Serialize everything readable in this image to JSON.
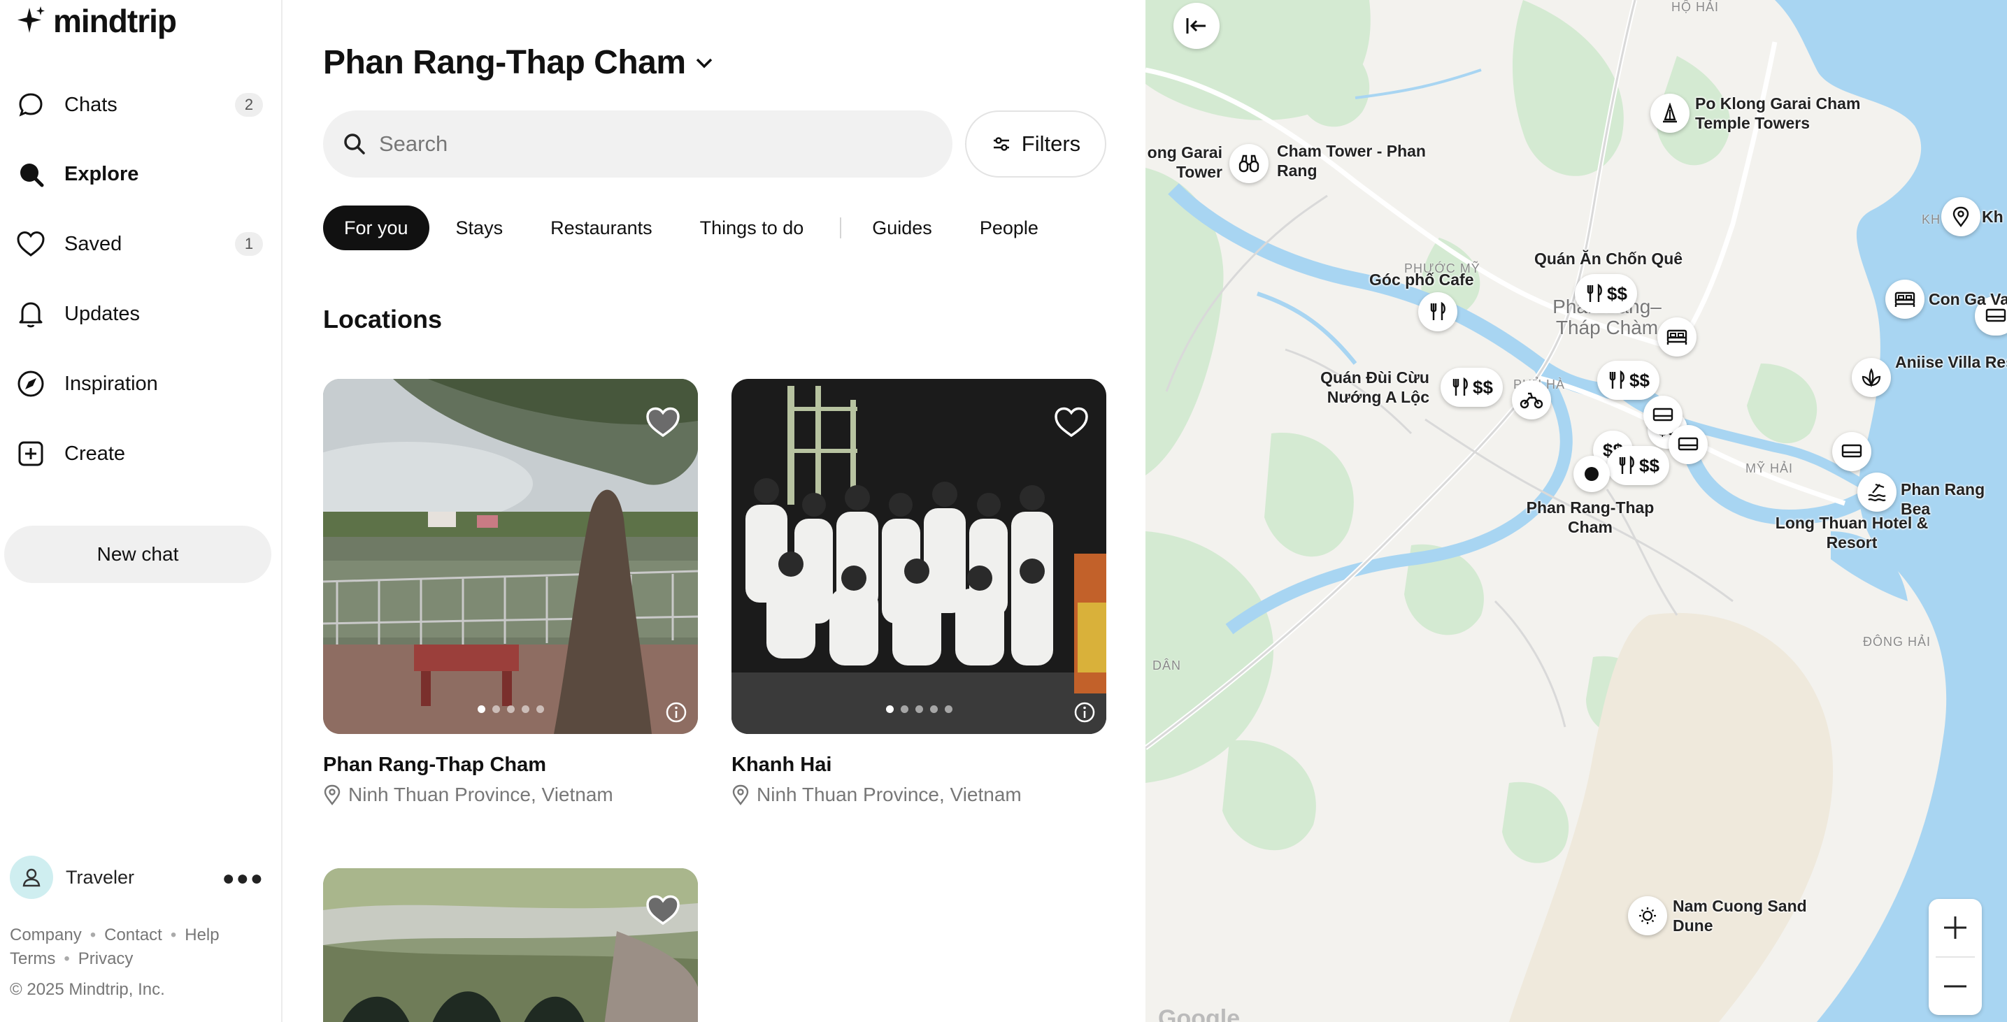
{
  "app": {
    "name": "mindtrip"
  },
  "sidebar": {
    "items": [
      {
        "label": "Chats",
        "count": "2",
        "icon": "chat-bubble-icon"
      },
      {
        "label": "Explore",
        "icon": "search-icon"
      },
      {
        "label": "Saved",
        "count": "1",
        "icon": "heart-icon"
      },
      {
        "label": "Updates",
        "icon": "bell-icon"
      },
      {
        "label": "Inspiration",
        "icon": "compass-icon"
      },
      {
        "label": "Create",
        "icon": "plus-square-icon"
      }
    ],
    "new_chat_label": "New chat",
    "user": {
      "name": "Traveler"
    },
    "footer": {
      "links_row1": [
        "Company",
        "Contact",
        "Help"
      ],
      "links_row2": [
        "Terms",
        "Privacy"
      ],
      "copyright": "© 2025 Mindtrip, Inc."
    }
  },
  "main": {
    "title": "Phan Rang-Thap Cham",
    "search": {
      "placeholder": "Search",
      "value": ""
    },
    "filters_label": "Filters",
    "tabs": [
      {
        "label": "For you",
        "active": true
      },
      {
        "label": "Stays"
      },
      {
        "label": "Restaurants"
      },
      {
        "label": "Things to do"
      },
      {
        "label": "Guides"
      },
      {
        "label": "People"
      }
    ],
    "section_title": "Locations",
    "cards": [
      {
        "title": "Phan Rang-Thap Cham",
        "location": "Ninh Thuan Province, Vietnam",
        "saved": true,
        "photo_count": 5,
        "active_photo": 1
      },
      {
        "title": "Khanh Hai",
        "location": "Ninh Thuan Province, Vietnam",
        "saved": false,
        "photo_count": 5,
        "active_photo": 1
      },
      {
        "title": "",
        "location": "",
        "saved": true
      }
    ]
  },
  "map": {
    "labels": {
      "po_klong": "Po Klong Garai Cham Temple Towers",
      "cham_tower": "Cham Tower - Phan Rang",
      "ong_garai": "ong Garai Tower",
      "quan_an": "Quán Ăn Chốn Quê",
      "goc_pho": "Góc phố Cafe",
      "quan_dui": "Quán Đùi Cừu Nướng A Lộc",
      "con_ga": "Con Ga Va",
      "aniise": "Aniise Villa Res",
      "phan_rang_bea": "Phan Rang Bea",
      "long_thuan": "Long Thuan Hotel & Resort",
      "phan_rang_thap_cham": "Phan Rang-Thap Cham",
      "nam_cuong": "Nam Cuong Sand Dune",
      "kh": "Kh"
    },
    "city_label": "Phan Rang–Tháp Chàm",
    "faint_labels": {
      "ho_hai": "HỘ HẢI",
      "phuoc_my": "PHƯỚC MỸ",
      "phu_ha": "PHỦ HÀ",
      "my_hai": "MỸ HẢI",
      "dong_hai": "ĐÔNG HẢI",
      "dan": "DÂN",
      "kh": "KH"
    },
    "prices": [
      "$$",
      "$$",
      "$$",
      "$$",
      "$$",
      "$$"
    ],
    "google": "Google"
  }
}
